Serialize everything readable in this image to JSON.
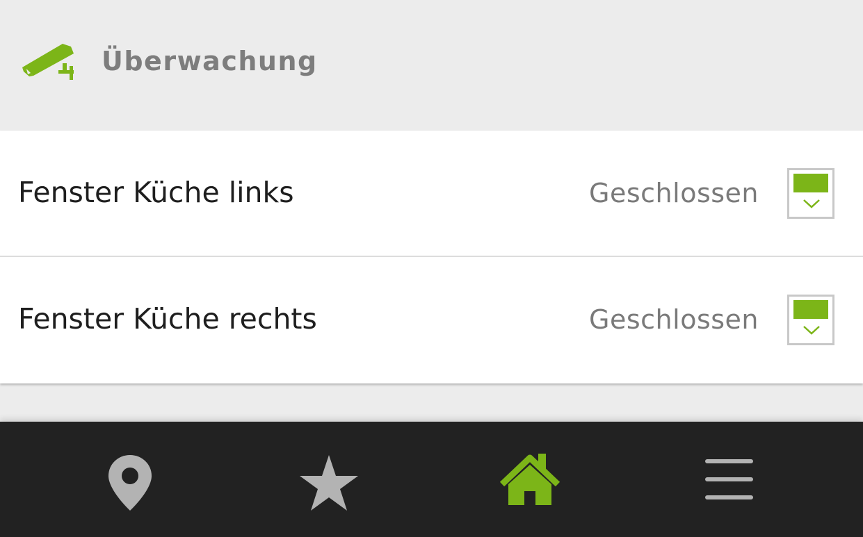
{
  "header": {
    "title": "Überwachung",
    "icon": "security-camera-icon"
  },
  "devices": [
    {
      "name": "Fenster Küche links",
      "status": "Geschlossen",
      "icon": "window-closed-icon"
    },
    {
      "name": "Fenster Küche rechts",
      "status": "Geschlossen",
      "icon": "window-closed-icon"
    }
  ],
  "navbar": {
    "items": [
      {
        "name": "location",
        "icon": "map-pin-icon",
        "active": false
      },
      {
        "name": "favorites",
        "icon": "star-icon",
        "active": false
      },
      {
        "name": "home",
        "icon": "home-icon",
        "active": true
      },
      {
        "name": "menu",
        "icon": "hamburger-menu-icon",
        "active": false
      }
    ]
  },
  "colors": {
    "accent": "#7cb518",
    "navbar_bg": "#222222",
    "nav_icon_inactive": "#b3b3b3",
    "header_bg": "#ececec"
  }
}
